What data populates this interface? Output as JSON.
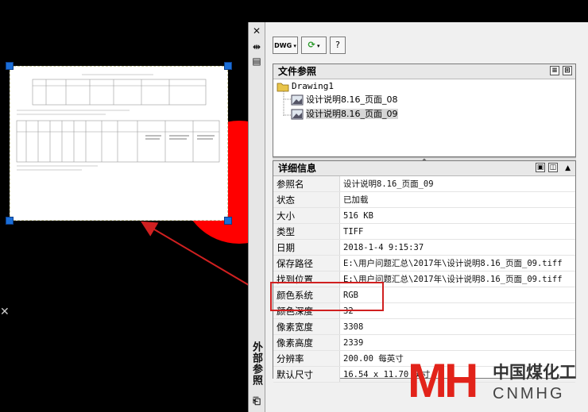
{
  "palette": {
    "title": "外部参照",
    "close_glyph": "✕",
    "toolbar": {
      "attach_label": "DWG",
      "help_label": "?"
    },
    "file_refs": {
      "header": "文件参照",
      "root": "Drawing1",
      "children": [
        "设计说明8.16_页面_08",
        "设计说明8.16_页面_09"
      ],
      "selected_index": 1
    },
    "details": {
      "header": "详细信息",
      "rows": [
        {
          "key": "参照名",
          "value": "设计说明8.16_页面_09"
        },
        {
          "key": "状态",
          "value": "已加载"
        },
        {
          "key": "大小",
          "value": "516 KB"
        },
        {
          "key": "类型",
          "value": "TIFF"
        },
        {
          "key": "日期",
          "value": "2018-1-4 9:15:37"
        },
        {
          "key": "保存路径",
          "value": "E:\\用户问题汇总\\2017年\\设计说明8.16_页面_09.tiff"
        },
        {
          "key": "找到位置",
          "value": "E:\\用户问题汇总\\2017年\\设计说明8.16_页面_09.tiff"
        },
        {
          "key": "颜色系统",
          "value": "RGB"
        },
        {
          "key": "颜色深度",
          "value": "32"
        },
        {
          "key": "像素宽度",
          "value": "3308"
        },
        {
          "key": "像素高度",
          "value": "2339"
        },
        {
          "key": "分辨率",
          "value": "200.00 每英寸"
        },
        {
          "key": "默认尺寸",
          "value": "16.54 x 11.70 英寸"
        }
      ]
    }
  },
  "watermark": {
    "logo": "MH",
    "cn": "中国煤化工",
    "en": "CNMHG"
  },
  "colors": {
    "highlight": "#d02020",
    "grip": "#1a6ed8",
    "shape": "#ff0000"
  }
}
